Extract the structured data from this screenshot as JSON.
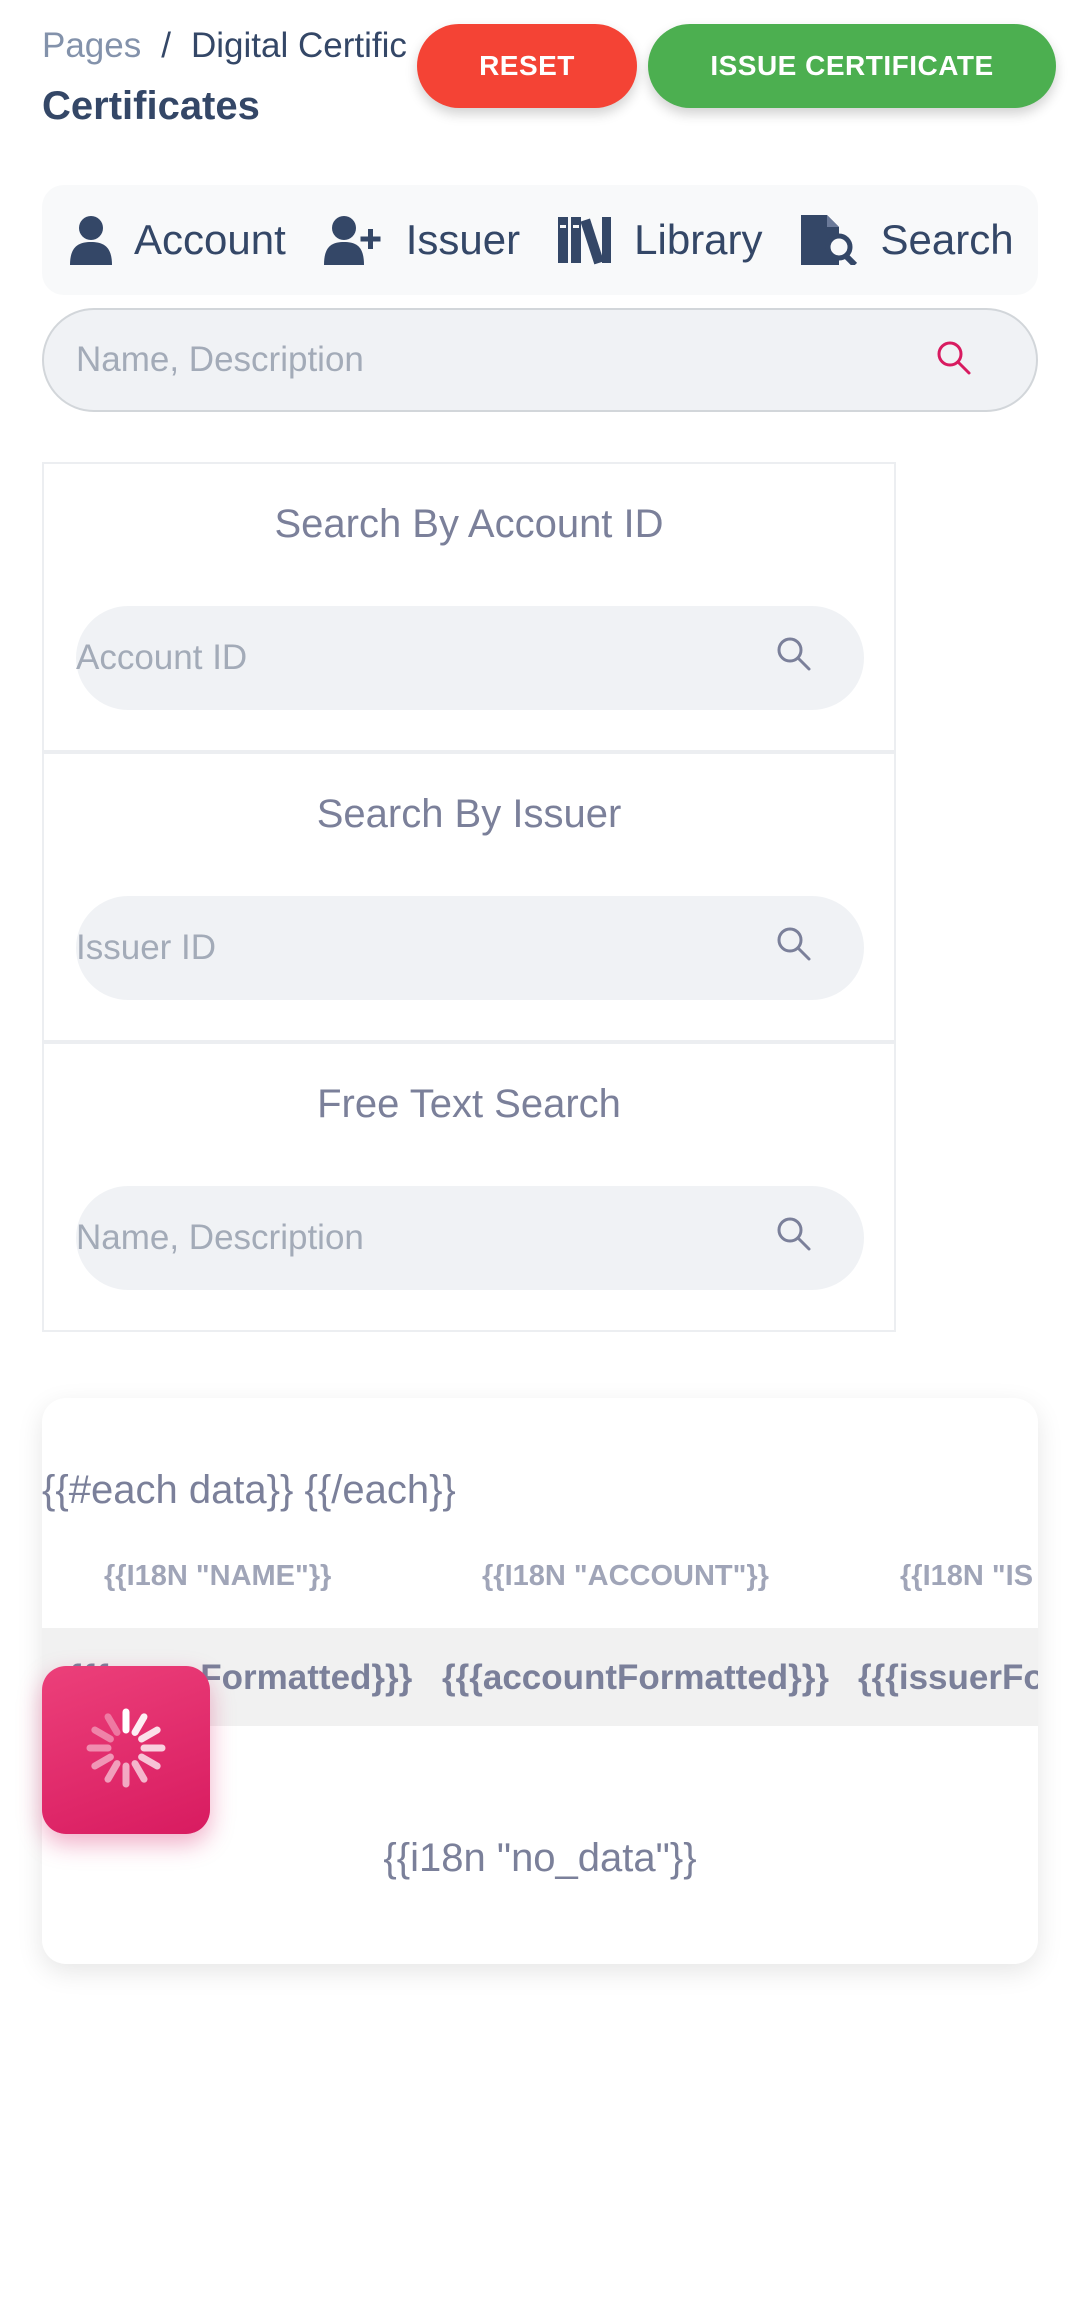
{
  "breadcrumb": {
    "root": "Pages",
    "separator": "/",
    "current": "Digital Certific"
  },
  "page_title": "Certificates",
  "buttons": {
    "reset": "RESET",
    "issue": "ISSUE CERTIFICATE"
  },
  "colors": {
    "reset": "#f44335",
    "issue": "#4caf50",
    "accent": "#d81b60",
    "text": "#344767"
  },
  "nav": {
    "items": [
      {
        "label": "Account",
        "icon": "user-icon"
      },
      {
        "label": "Issuer",
        "icon": "user-plus-icon"
      },
      {
        "label": "Library",
        "icon": "books-icon"
      },
      {
        "label": "Search",
        "icon": "file-search-icon"
      }
    ]
  },
  "main_search": {
    "placeholder": "Name, Description",
    "icon": "search-icon"
  },
  "panels": [
    {
      "title": "Search By Account ID",
      "placeholder": "Account ID",
      "icon": "search-icon"
    },
    {
      "title": "Search By Issuer",
      "placeholder": "Issuer ID",
      "icon": "search-icon"
    },
    {
      "title": "Free Text Search",
      "placeholder": "Name, Description",
      "icon": "search-icon"
    }
  ],
  "table": {
    "template_text": "{{#each data}} {{/each}}",
    "headers": [
      "{{I18N \"NAME\"}}",
      "{{I18N \"ACCOUNT\"}}",
      "{{I18N \"IS"
    ],
    "row": [
      "{{{nameFormatted}}}",
      "{{{accountFormatted}}}",
      "{{{issuerFo"
    ],
    "no_data": "{{i18n \"no_data\"}}"
  },
  "spinner": {
    "icon": "loading-spinner-icon"
  }
}
